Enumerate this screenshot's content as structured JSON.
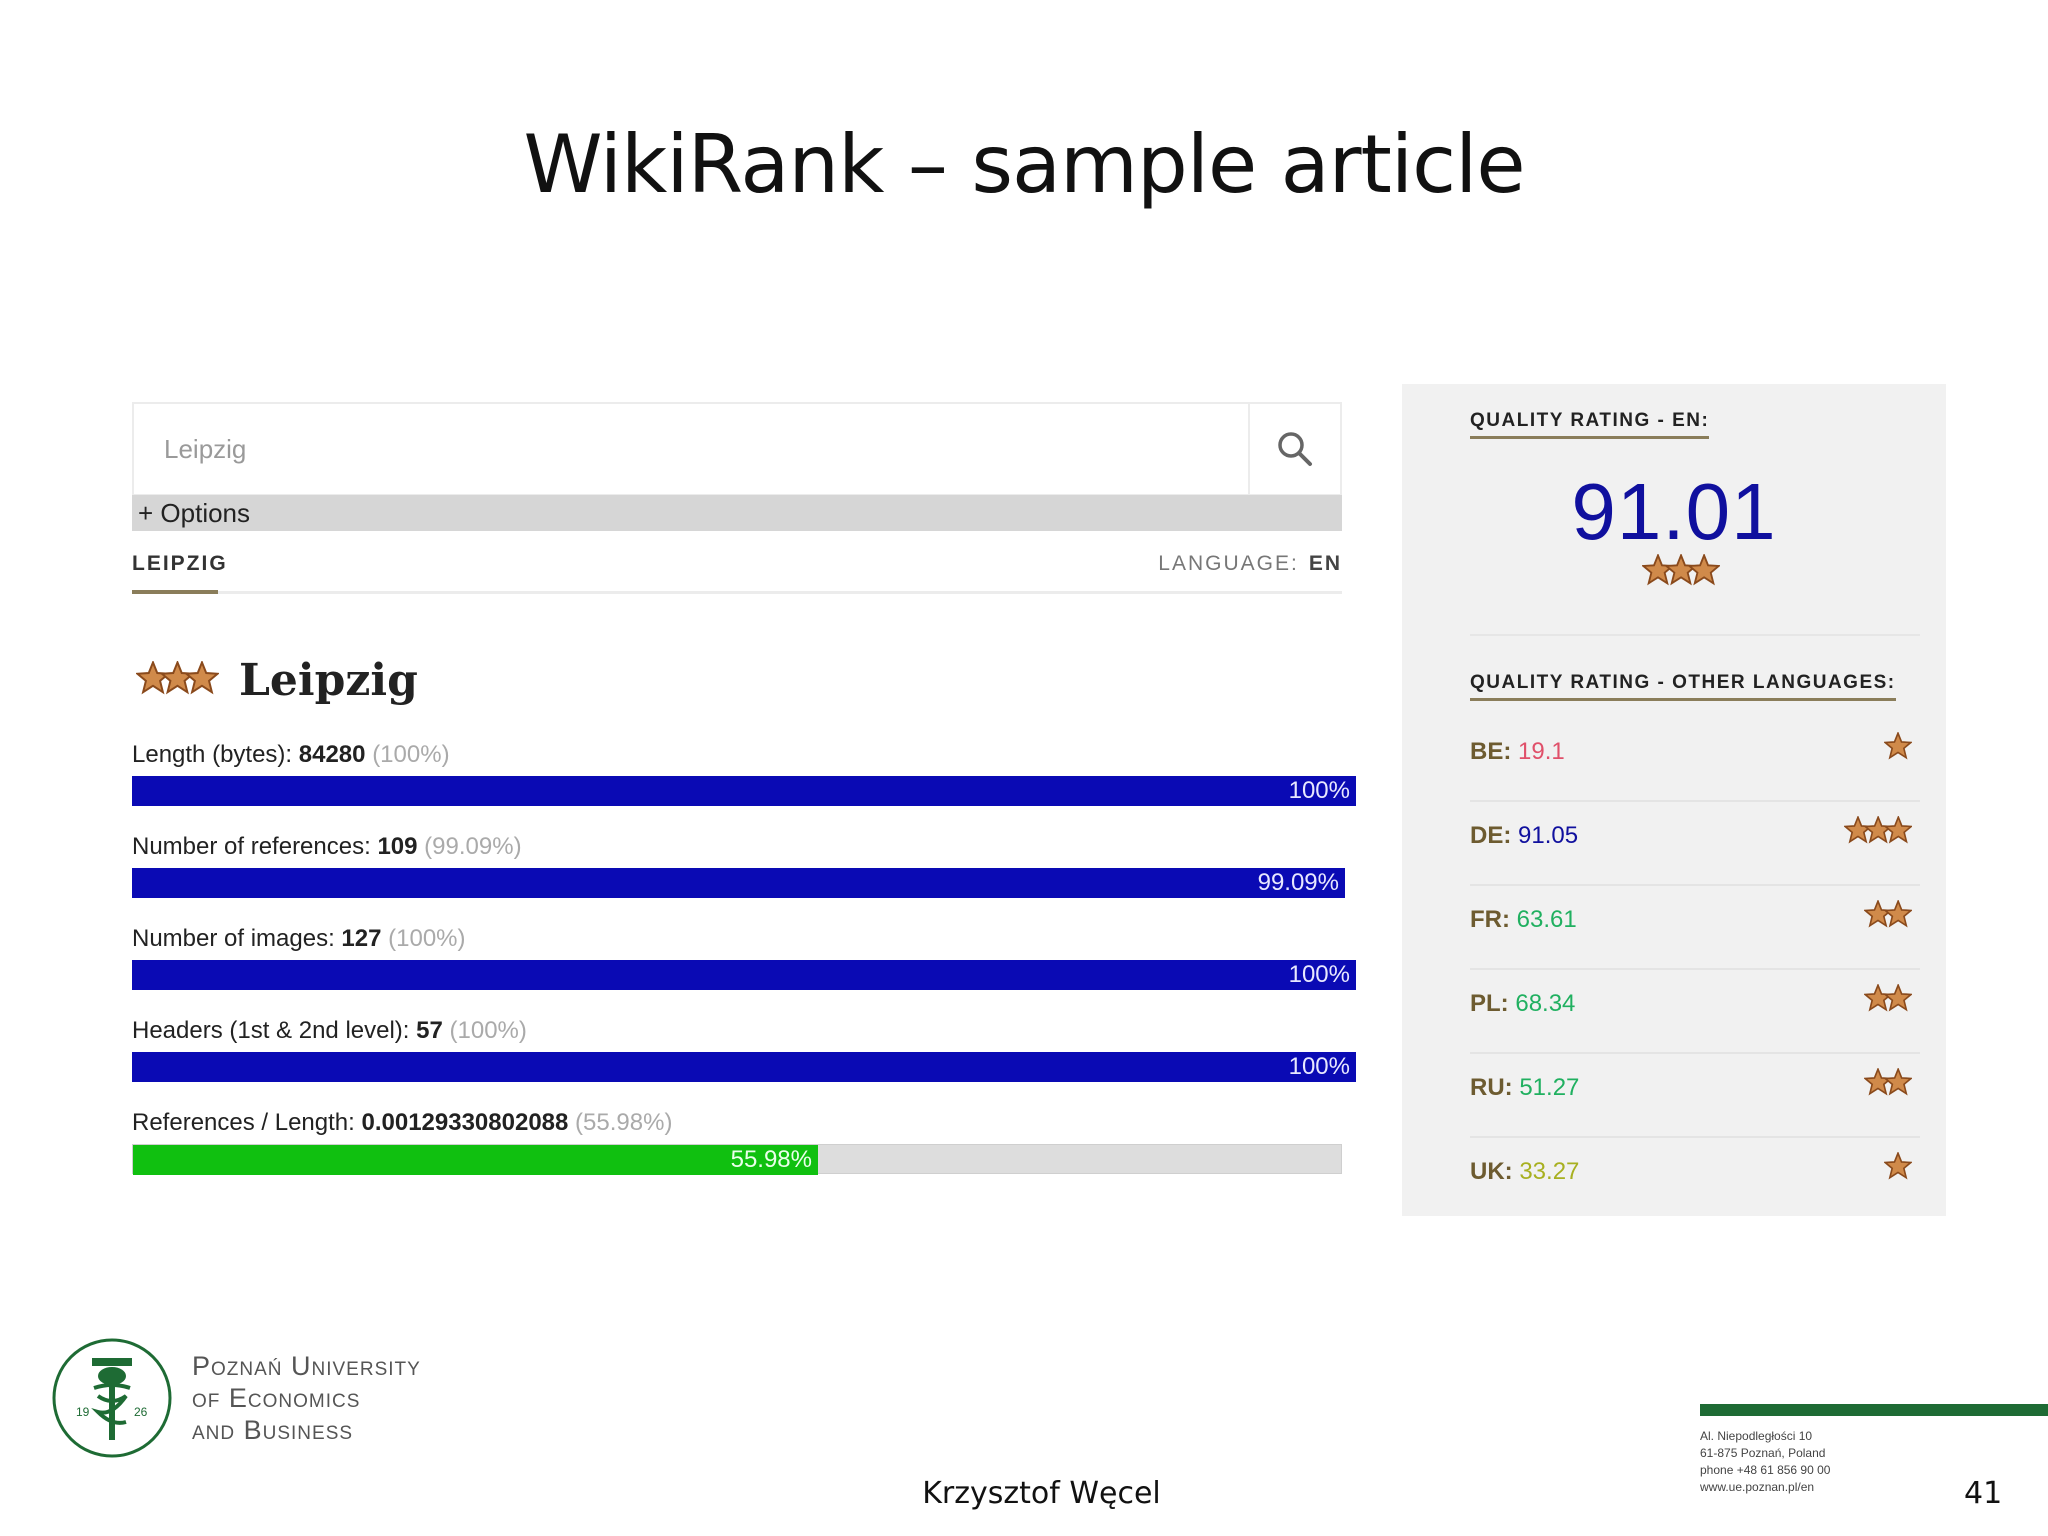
{
  "slide": {
    "title": "WikiRank – sample article",
    "author": "Krzysztof Węcel",
    "page_number": "41"
  },
  "search": {
    "placeholder": "Leipzig",
    "options_label": "+ Options"
  },
  "article": {
    "tab_label": "LEIPZIG",
    "language_label": "LANGUAGE:",
    "language_value": "EN",
    "title": "Leipzig",
    "stars": 3
  },
  "metrics": [
    {
      "label": "Length (bytes):",
      "value": "84280",
      "percent_text": "(100%)",
      "bar_text": "100%",
      "fraction": 1.0,
      "color": "#0a0ab4"
    },
    {
      "label": "Number of references:",
      "value": "109",
      "percent_text": "(99.09%)",
      "bar_text": "99.09%",
      "fraction": 0.9909,
      "color": "#0a0ab4"
    },
    {
      "label": "Number of images:",
      "value": "127",
      "percent_text": "(100%)",
      "bar_text": "100%",
      "fraction": 1.0,
      "color": "#0a0ab4"
    },
    {
      "label": "Headers (1st & 2nd level):",
      "value": "57",
      "percent_text": "(100%)",
      "bar_text": "100%",
      "fraction": 1.0,
      "color": "#0a0ab4"
    },
    {
      "label": "References / Length:",
      "value": "0.00129330802088",
      "percent_text": "(55.98%)",
      "bar_text": "55.98%",
      "fraction": 0.5598,
      "color": "#10c010"
    }
  ],
  "quality": {
    "heading_en": "QUALITY RATING - EN:",
    "score_en": "91.01",
    "stars_en": 3,
    "heading_other": "QUALITY RATING - OTHER LANGUAGES:",
    "languages": [
      {
        "code": "BE:",
        "score": "19.1",
        "stars": 1,
        "color": "#e0506a"
      },
      {
        "code": "DE:",
        "score": "91.05",
        "stars": 3,
        "color": "#10109e"
      },
      {
        "code": "FR:",
        "score": "63.61",
        "stars": 2,
        "color": "#20b060"
      },
      {
        "code": "PL:",
        "score": "68.34",
        "stars": 2,
        "color": "#20b060"
      },
      {
        "code": "RU:",
        "score": "51.27",
        "stars": 2,
        "color": "#20b060"
      },
      {
        "code": "UK:",
        "score": "33.27",
        "stars": 1,
        "color": "#a8b020"
      }
    ]
  },
  "university": {
    "line1": "Poznań University",
    "line2": "of Economics",
    "line3": "and Business",
    "year_left": "19",
    "year_right": "26"
  },
  "address": {
    "line1": "Al. Niepodległości 10",
    "line2": "61-875 Poznań, Poland",
    "line3": "phone +48 61 856 90 00",
    "line4": "www.ue.poznan.pl/en"
  },
  "colors": {
    "bar_blue": "#0a0ab4",
    "bar_green": "#10c010",
    "accent_gold": "#8a7d5a",
    "score_blue": "#10109e",
    "university_green": "#1e6b34"
  }
}
